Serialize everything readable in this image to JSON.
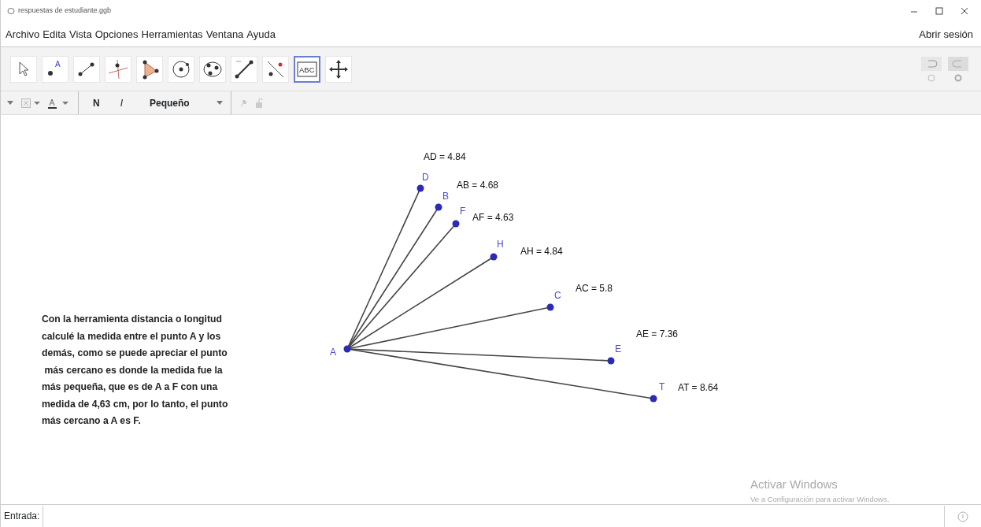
{
  "window": {
    "title": "respuestas de estudiante.ggb"
  },
  "menu": [
    "Archivo",
    "Edita",
    "Vista",
    "Opciones",
    "Herramientas",
    "Ventana",
    "Ayuda"
  ],
  "sign_in": "Abrir sesión",
  "tools": [
    {
      "kind": "move",
      "selected": false
    },
    {
      "kind": "point",
      "selected": false,
      "label": "A"
    },
    {
      "kind": "segment",
      "selected": false
    },
    {
      "kind": "perpendicular",
      "selected": false
    },
    {
      "kind": "polygon",
      "selected": false
    },
    {
      "kind": "circle",
      "selected": false
    },
    {
      "kind": "conic",
      "selected": false
    },
    {
      "kind": "measure",
      "selected": false
    },
    {
      "kind": "reflect",
      "selected": false
    },
    {
      "kind": "text",
      "selected": true,
      "label": "ABC"
    },
    {
      "kind": "pan",
      "selected": false
    }
  ],
  "style_bar": {
    "bold": "N",
    "italic": "I",
    "size": "Pequeño"
  },
  "points": [
    {
      "name": "A"
    },
    {
      "name": "D"
    },
    {
      "name": "B"
    },
    {
      "name": "F"
    },
    {
      "name": "H"
    },
    {
      "name": "C"
    },
    {
      "name": "E"
    },
    {
      "name": "T"
    }
  ],
  "measures": [
    {
      "text": "AD = 4.84"
    },
    {
      "text": "AB = 4.68"
    },
    {
      "text": "AF = 4.63"
    },
    {
      "text": "AH = 4.84"
    },
    {
      "text": "AC = 5.8"
    },
    {
      "text": "AE = 7.36"
    },
    {
      "text": "AT = 8.64"
    }
  ],
  "note": "Con la herramienta distancia o longitud\ncalculé la medida entre el punto A y los\ndemás, como se puede apreciar el punto\n más cercano es donde la medida fue la\nmás pequeña, que es de A a F con una\nmedida de 4,63 cm, por lo tanto, el punto\nmás cercano a A es F.",
  "activation": {
    "title": "Activar Windows",
    "subtitle": "Ve a Configuración para activar Windows."
  },
  "input_bar": {
    "label": "Entrada:"
  }
}
